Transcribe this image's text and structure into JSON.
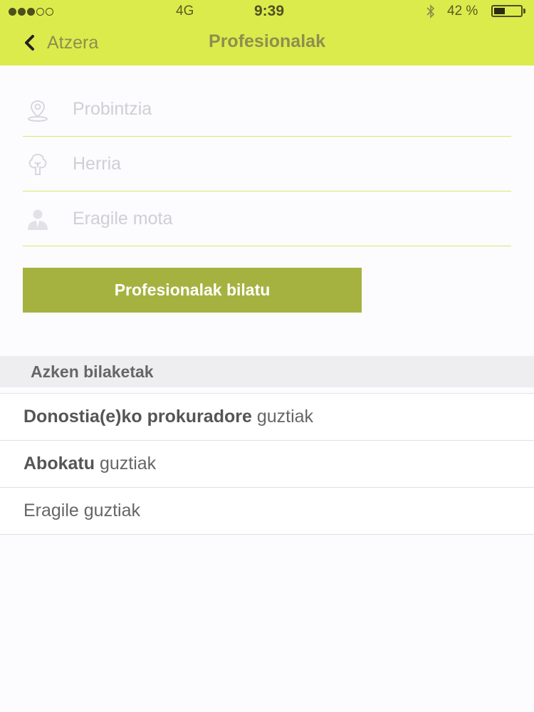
{
  "status_bar": {
    "network": "4G",
    "time": "9:39",
    "battery": "42 %",
    "battery_level": 0.42
  },
  "nav": {
    "back_label": "Atzera",
    "title": "Profesionalak"
  },
  "form": {
    "province_placeholder": "Probintzia",
    "town_placeholder": "Herria",
    "agent_type_placeholder": "Eragile mota",
    "search_button": "Profesionalak bilatu"
  },
  "recent": {
    "header": "Azken bilaketak",
    "items": [
      {
        "bold": "Donostia(e)ko prokuradore",
        "rest": " guztiak"
      },
      {
        "bold": "Abokatu",
        "rest": " guztiak"
      },
      {
        "bold": "",
        "rest": "Eragile guztiak"
      }
    ]
  },
  "colors": {
    "accent": "#dbeb4c",
    "button": "#a6b240"
  }
}
